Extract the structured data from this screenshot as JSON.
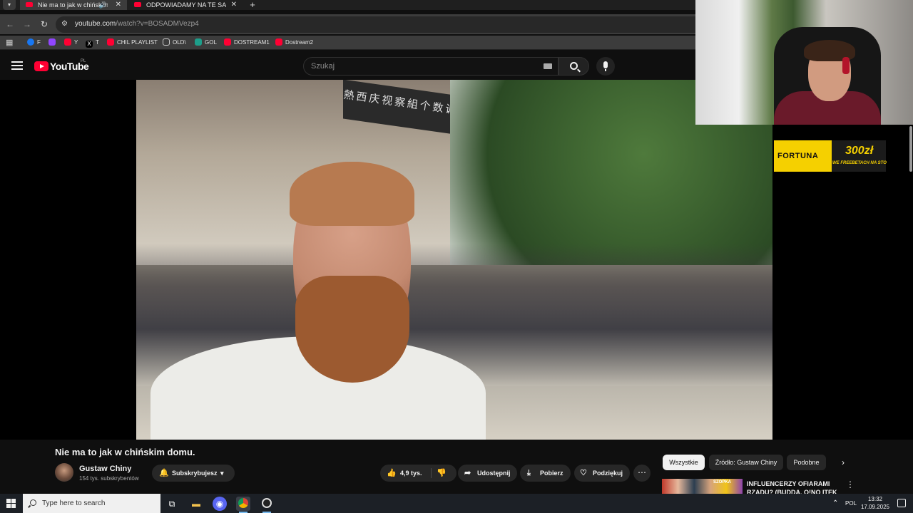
{
  "browser": {
    "tabs": [
      {
        "title": "Nie ma to jak w chińskim d",
        "active": true,
        "audio": "🔊"
      },
      {
        "title": "ODPOWIADAMY NA TE SAME P",
        "active": false
      }
    ],
    "close_glyph": "✕",
    "new_tab_glyph": "+",
    "url_main": "youtube.com",
    "url_rest": "/watch?v=BOSADMVezp4",
    "bookmarks": [
      {
        "label": "F",
        "color": "#1877f2"
      },
      {
        "label": "",
        "color": "#9146ff"
      },
      {
        "label": "Y",
        "color": "#ff0033"
      },
      {
        "label": "T",
        "color": "#000000"
      },
      {
        "label": "CHIL PLAYLIST",
        "color": "#ff0033"
      },
      {
        "label": "OLD\\",
        "color": ""
      },
      {
        "label": "GOL",
        "color": "#1d9e8a"
      },
      {
        "label": "DOSTREAM1",
        "color": "#ff0033"
      },
      {
        "label": "Dostream2",
        "color": "#ff0033"
      }
    ]
  },
  "youtube": {
    "logo_text": "YouTube",
    "region": "PL",
    "search_placeholder": "Szukaj",
    "video_title": "Nie ma to jak w chińskim domu.",
    "channel_name": "Gustaw Chiny",
    "channel_subs": "154 tys. subskrybentów",
    "subscribe_label": "Subskrybujesz",
    "like_count": "4,9 tys.",
    "share_label": "Udostępnij",
    "download_label": "Pobierz",
    "thanks_label": "Podziękuj",
    "chips": [
      "Wszystkie",
      "Źródło: Gustaw Chiny",
      "Podobne"
    ],
    "recommended": {
      "title": "INFLUENCERZY OFIARAMI RZĄDU? (BUDDA, O!NO ITEK",
      "thumb_text": "SZOPKA"
    }
  },
  "ad": {
    "brand": "FORTUNA",
    "amount": "300zł",
    "subtext": "WE FREEBETACH NA STO"
  },
  "video_sign": "熱西庆视察組个数调字",
  "taskbar": {
    "search_placeholder": "Type here to search",
    "language": "POL",
    "time": "13:32",
    "date": "17.09.2025"
  },
  "colors": {
    "yt_red": "#ff0033",
    "fortuna_yellow": "#f5d000",
    "bg": "#0f0f0f"
  }
}
